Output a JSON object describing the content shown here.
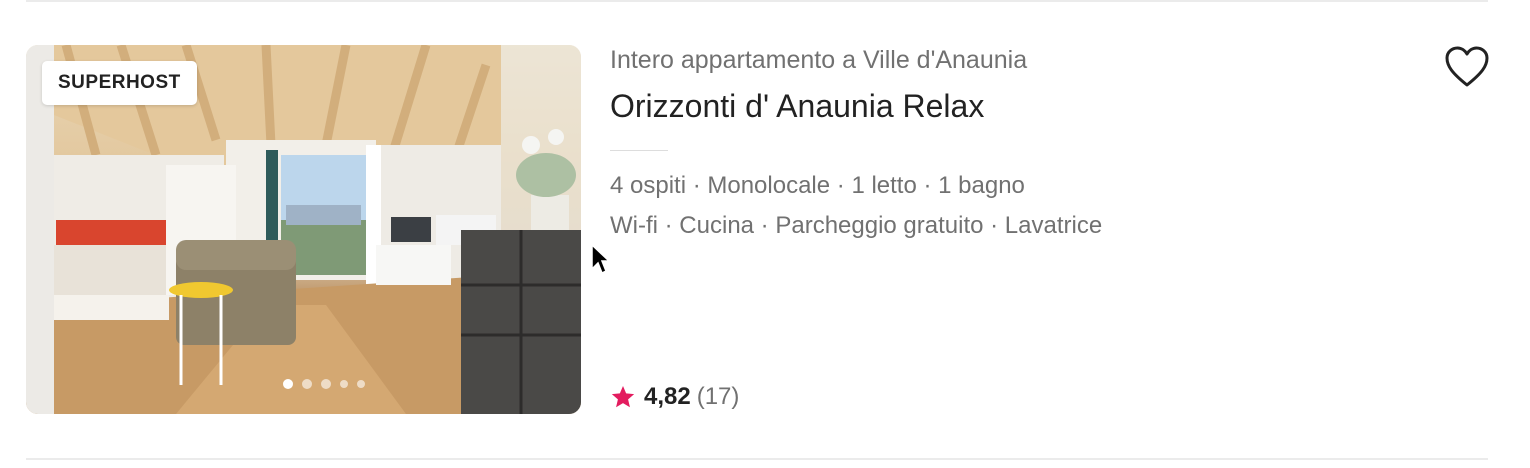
{
  "listing": {
    "badge": "SUPERHOST",
    "subtitle": "Intero appartamento a Ville d'Anaunia",
    "title": "Orizzonti d' Anaunia Relax",
    "details_line1": "4 ospiti · Monolocale · 1 letto · 1 bagno",
    "details_line2": "Wi-fi · Cucina · Parcheggio gratuito · Lavatrice",
    "rating": {
      "score": "4,82",
      "count": "(17)"
    },
    "photo_count": 5,
    "active_photo_index": 0,
    "icons": {
      "wishlist": "heart-icon",
      "rating": "star-icon"
    },
    "colors": {
      "star": "#e31c5f",
      "text_primary": "#222222",
      "text_secondary": "#717171"
    }
  }
}
